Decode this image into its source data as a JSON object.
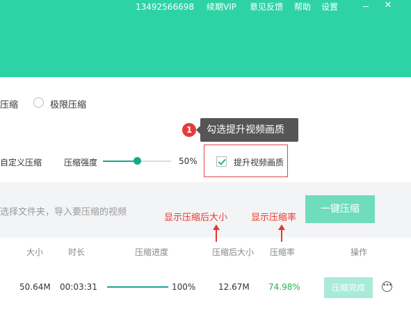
{
  "topbar": {
    "phone": "13492566698",
    "renew_vip": "续期VIP",
    "feedback": "意见反馈",
    "help": "帮助",
    "settings": "设置"
  },
  "options": {
    "mode_partial": "压缩",
    "mode_extreme": "极限压缩",
    "custom_compress": "自定义压缩",
    "strength_label": "压缩强度",
    "strength_value": "50%",
    "strength_fraction": 0.5,
    "enhance_quality": "提升视频画质"
  },
  "tooltip": {
    "step": "1",
    "text": "勾选提升视频画质"
  },
  "drop": {
    "hint": "选择文件夹，导入要压缩的视频",
    "button": "一键压缩"
  },
  "annotations": {
    "size_after": "显示压缩后大小",
    "ratio": "显示压缩率"
  },
  "table": {
    "headers": {
      "size": "大小",
      "duration": "时长",
      "progress": "压缩进度",
      "size_after": "压缩后大小",
      "ratio": "压缩率",
      "action": "操作"
    },
    "rows": [
      {
        "size": "50.64M",
        "duration": "00:03:31",
        "progress_fraction": 1.0,
        "progress": "100%",
        "size_after": "12.67M",
        "ratio": "74.98%",
        "action": "压缩完成"
      }
    ]
  },
  "colors": {
    "header": "#2ed3a5",
    "accent": "#17a88a",
    "button": "#6fdcbc",
    "annotation": "#e8372e",
    "ratio_text": "#22b24c"
  }
}
